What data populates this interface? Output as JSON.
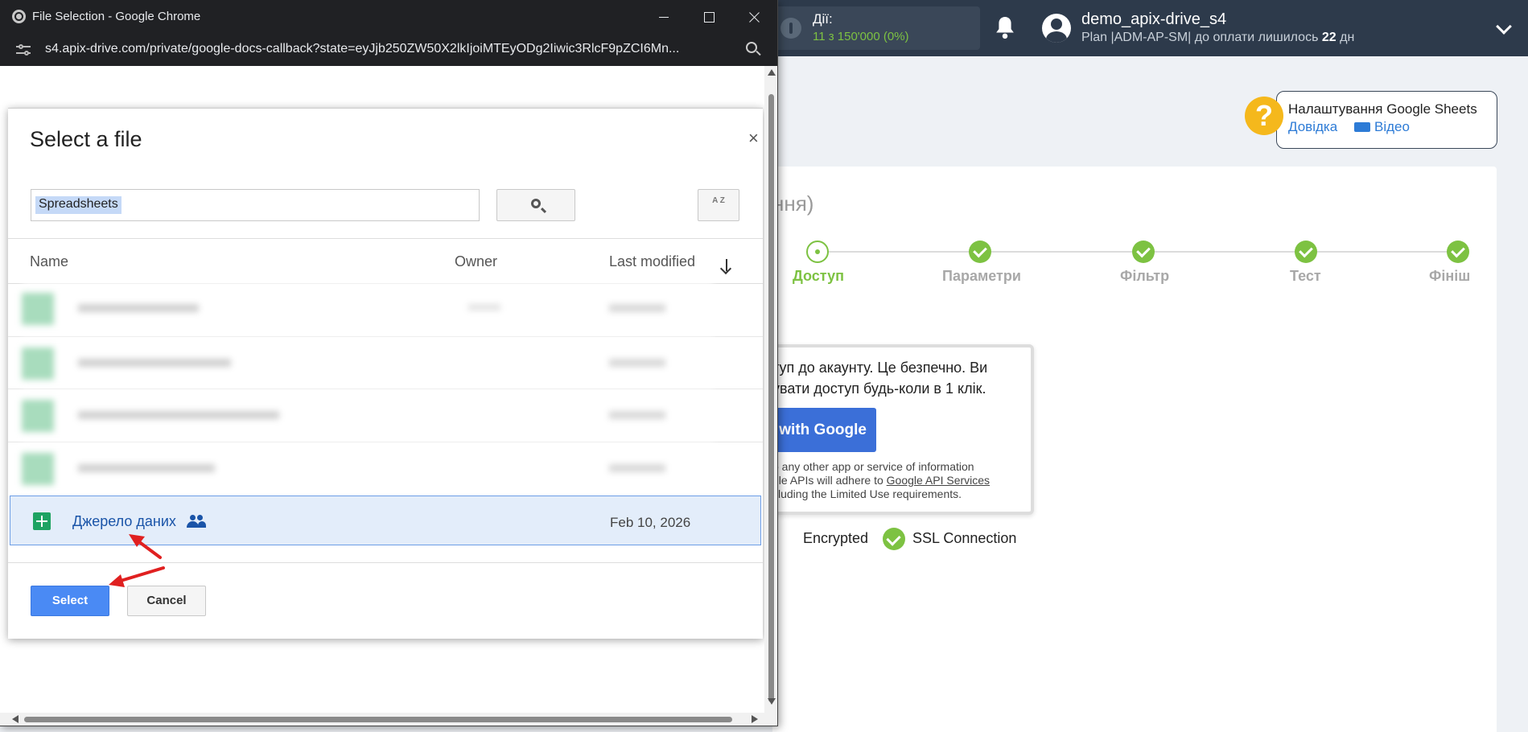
{
  "background_app": {
    "actions": {
      "label": "Дії:",
      "value": "11 з 150'000 (0%)"
    },
    "user": {
      "name": "demo_apix-drive_s4",
      "plan_prefix": "Plan |ADM-AP-SM| до оплати лишилось ",
      "plan_days": "22",
      "plan_suffix": " дн"
    },
    "help": {
      "title": "Налаштування Google Sheets",
      "link_help": "Довідка",
      "link_video": "Відео"
    },
    "card_title": "ння)",
    "steps": [
      {
        "label": "Доступ",
        "state": "current"
      },
      {
        "label": "Параметри",
        "state": "done"
      },
      {
        "label": "Фільтр",
        "state": "done"
      },
      {
        "label": "Тест",
        "state": "done"
      },
      {
        "label": "Фініш",
        "state": "done"
      }
    ],
    "access_text": "туп до акаунту. Це безпечно. Ви\nувати доступ будь-коли в 1 клік.",
    "google_button": "with Google",
    "disclaimer_part1": "o any other app or service of information\ngle APIs will adhere to ",
    "disclaimer_link": "Google API Services",
    "disclaimer_part2": "\ncluding the Limited Use requirements.",
    "encrypted_label": "Encrypted",
    "ssl_label": "SSL Connection",
    "colors": {
      "topbar": "#2d3a4b",
      "accent_green": "#7dc242",
      "link_blue": "#2d7bd6",
      "help_yellow": "#f5b81c"
    }
  },
  "chrome_window": {
    "title": "File Selection - Google Chrome",
    "url": "s4.apix-drive.com/private/google-docs-callback?state=eyJjb250ZW50X2lkIjoiMTEyODg2Iiwic3RlcF9pZCI6Mn..."
  },
  "picker": {
    "title": "Select a file",
    "close": "×",
    "search_value": "Spreadsheets",
    "sort_label": "A Z",
    "columns": {
      "name": "Name",
      "owner": "Owner",
      "modified": "Last modified"
    },
    "selected_file": {
      "name": "Джерело даних",
      "modified": "Feb 10, 2026",
      "shared": true
    },
    "buttons": {
      "select": "Select",
      "cancel": "Cancel"
    },
    "colors": {
      "primary": "#4a8af4",
      "selected_row": "#e3edfa",
      "sheets_green": "#1ea362"
    }
  }
}
